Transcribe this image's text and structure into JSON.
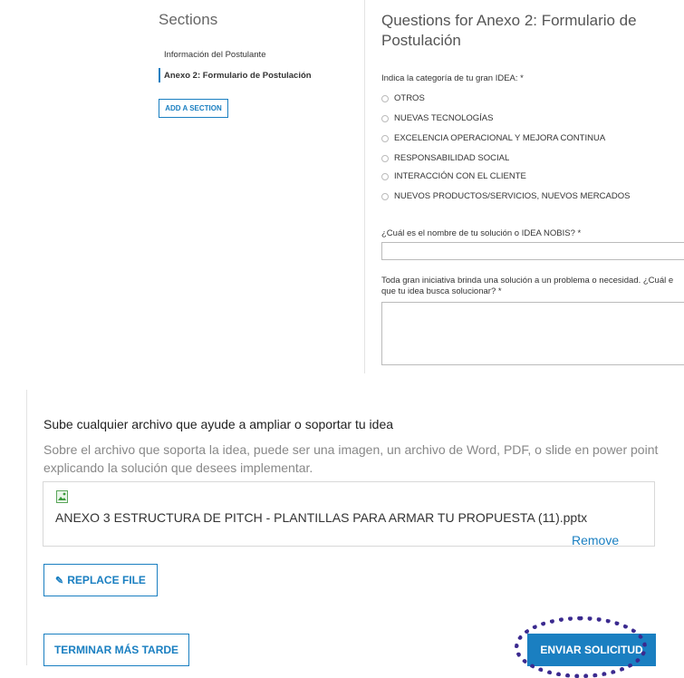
{
  "sections": {
    "title": "Sections",
    "items": [
      {
        "label": "Información del Postulante"
      },
      {
        "label": "Anexo 2: Formulario de Postulación"
      }
    ],
    "add_button": "ADD A SECTION"
  },
  "questions": {
    "title": "Questions for Anexo 2: Formulario de Postulación",
    "category_label": "Indica la categoría de tu gran IDEA: *",
    "options": [
      "OTROS",
      "NUEVAS TECNOLOGÍAS",
      "EXCELENCIA OPERACIONAL Y MEJORA CONTINUA",
      "RESPONSABILIDAD SOCIAL",
      "INTERACCIÓN CON EL CLIENTE",
      "NUEVOS PRODUCTOS/SERVICIOS, NUEVOS MERCADOS"
    ],
    "name_label": "¿Cuál es el nombre de tu solución o IDEA NOBIS? *",
    "problem_label_1": "Toda gran iniciativa brinda una solución a un problema o necesidad. ¿Cuál e",
    "problem_label_2": "que tu idea busca solucionar? *"
  },
  "upload": {
    "title": "Sube cualquier archivo que ayude a ampliar o soportar tu idea",
    "description": "Sobre el archivo que soporta la idea, puede ser una imagen, un archivo de Word, PDF, o slide en power point explicando la solución que desees implementar.",
    "file_name": "ANEXO 3 ESTRUCTURA DE PITCH - PLANTILLAS PARA ARMAR TU PROPUESTA (11).pptx",
    "remove": "Remove",
    "replace_button": "REPLACE FILE"
  },
  "actions": {
    "later_button": "TERMINAR MÁS TARDE",
    "submit_button": "ENVIAR SOLICITUD"
  },
  "icons": {
    "file": "image-file-icon",
    "replace": "paperclip-icon"
  },
  "colors": {
    "accent": "#1a7fc1",
    "highlight_ring": "#3b2a8f"
  }
}
